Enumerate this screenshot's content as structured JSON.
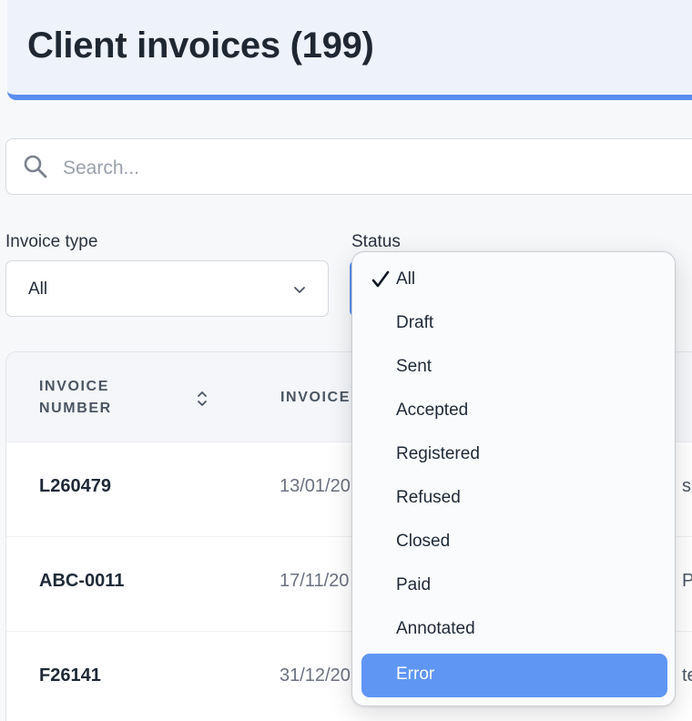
{
  "header": {
    "title": "Client invoices (199)"
  },
  "search": {
    "placeholder": "Search..."
  },
  "filters": {
    "invoice_type": {
      "label": "Invoice type",
      "value": "All"
    },
    "status": {
      "label": "Status"
    }
  },
  "table": {
    "columns": {
      "invoice_number_line1": "INVOICE",
      "invoice_number_line2": "NUMBER",
      "invoice_date": "INVOICE"
    },
    "rows": [
      {
        "number": "L260479",
        "date": "13/01/20",
        "extra": "s"
      },
      {
        "number": "ABC-0011",
        "date": "17/11/20",
        "extra": "PI"
      },
      {
        "number": "F26141",
        "date": "31/12/20",
        "extra": "ter"
      }
    ]
  },
  "status_dropdown": {
    "options": [
      "All",
      "Draft",
      "Sent",
      "Accepted",
      "Registered",
      "Refused",
      "Closed",
      "Paid",
      "Annotated",
      "Error"
    ],
    "checked": "All",
    "highlighted": "Error"
  },
  "colors": {
    "accent": "#5b8def",
    "highlight": "#5f96f4"
  }
}
